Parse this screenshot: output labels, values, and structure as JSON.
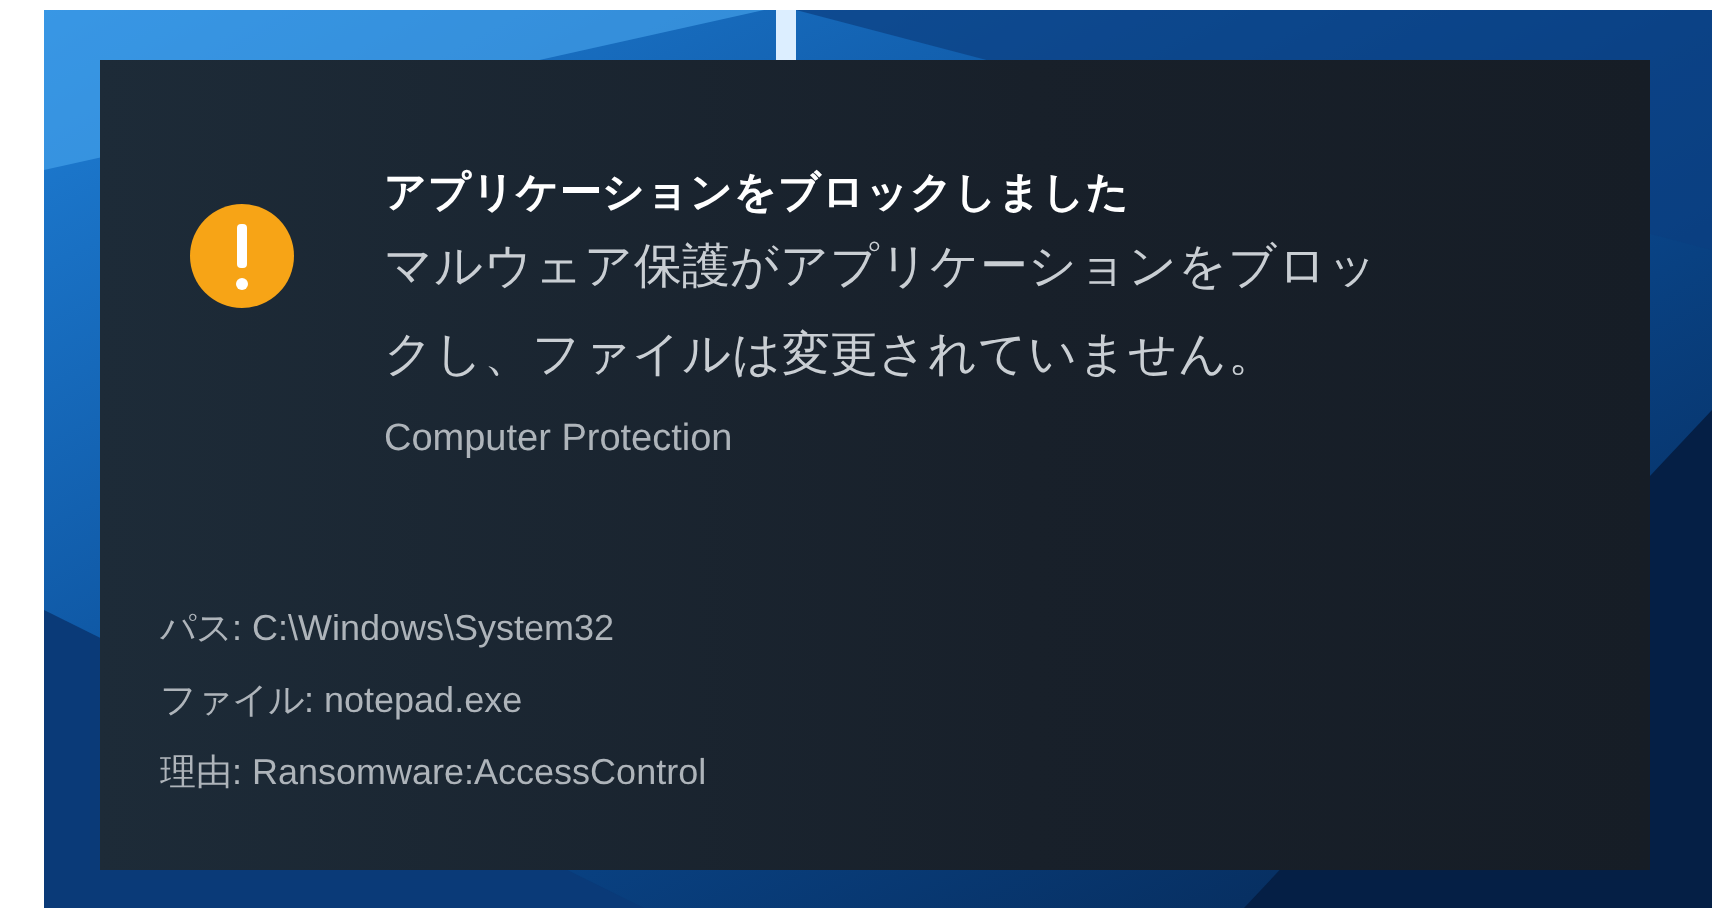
{
  "notification": {
    "title": "アプリケーションをブロックしました",
    "message": "マルウェア保護がアプリケーションをブロックし、ファイルは変更されていません。",
    "source": "Computer Protection",
    "details": [
      "パス: C:\\Windows\\System32",
      "ファイル: notepad.exe",
      "理由: Ransomware:AccessControl"
    ]
  }
}
